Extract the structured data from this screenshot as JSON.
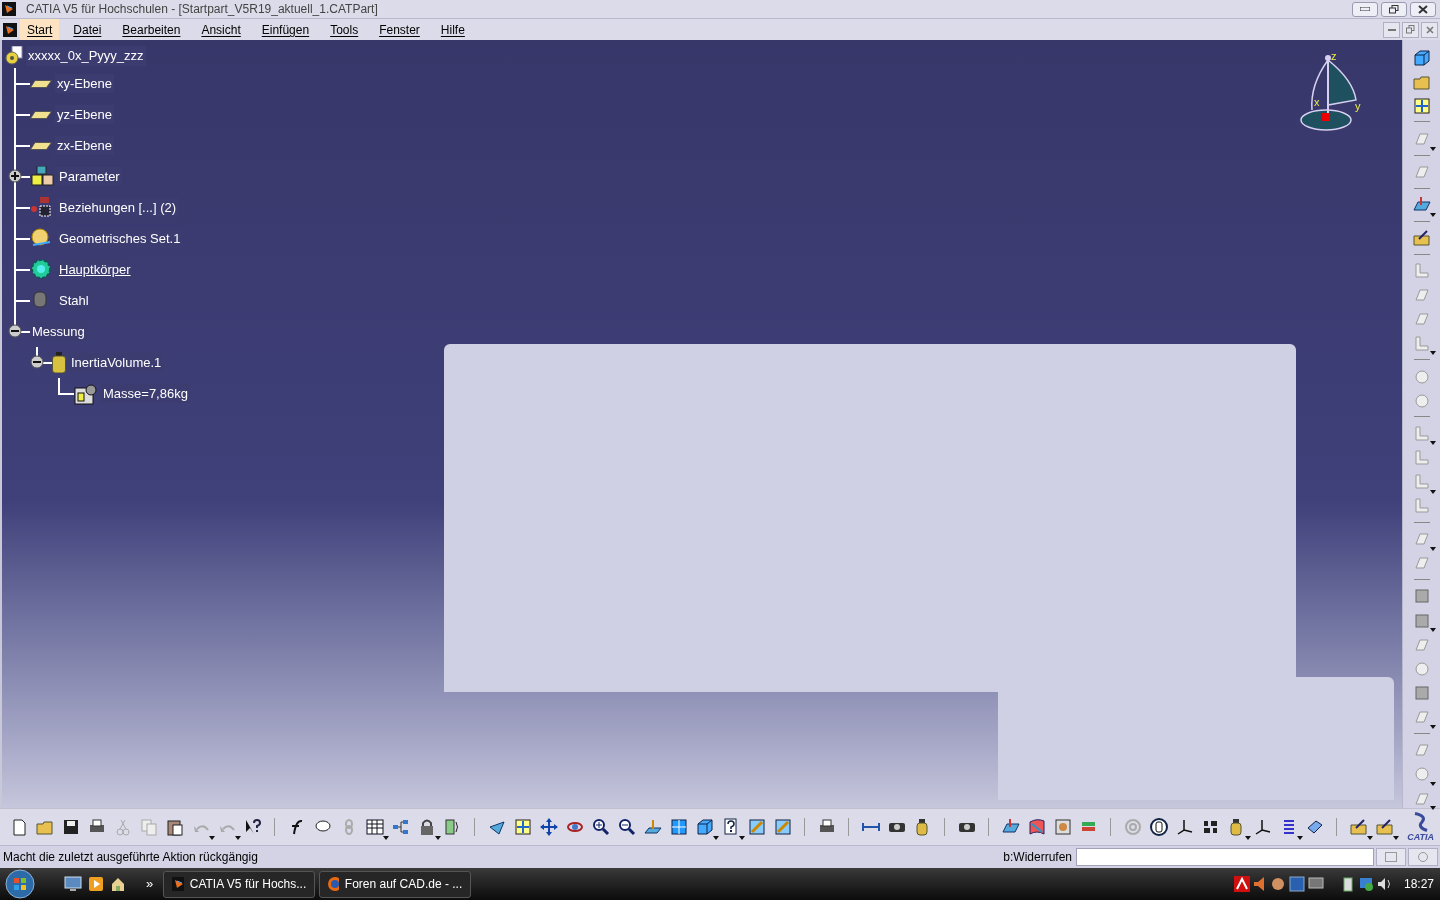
{
  "title_bar": {
    "title": "CATIA V5 für Hochschulen - [Startpart_V5R19_aktuell_1.CATPart]"
  },
  "menu": [
    {
      "label": "Start",
      "selected": true
    },
    {
      "label": "Datei",
      "selected": false
    },
    {
      "label": "Bearbeiten",
      "selected": false
    },
    {
      "label": "Ansicht",
      "selected": false
    },
    {
      "label": "Einfügen",
      "selected": false
    },
    {
      "label": "Tools",
      "selected": false
    },
    {
      "label": "Fenster",
      "selected": false
    },
    {
      "label": "Hilfe",
      "selected": false
    }
  ],
  "tree": {
    "label": "xxxxx_0x_Pyyy_zzz",
    "kind": "part",
    "children": [
      {
        "label": "xy-Ebene",
        "kind": "plane",
        "active": false
      },
      {
        "label": "yz-Ebene",
        "kind": "plane",
        "active": false
      },
      {
        "label": "zx-Ebene",
        "kind": "plane",
        "active": false
      },
      {
        "label": "Parameter",
        "kind": "parameter",
        "active": false,
        "expanded": false
      },
      {
        "label": "Beziehungen [...] (2)",
        "kind": "relations",
        "active": false
      },
      {
        "label": "Geometrisches Set.1",
        "kind": "geoset",
        "active": false
      },
      {
        "label": "Hauptkörper",
        "kind": "body",
        "active": true
      },
      {
        "label": "Stahl",
        "kind": "material",
        "active": false
      },
      {
        "label": "Messung",
        "kind": "measure",
        "active": false,
        "expanded": true,
        "children": [
          {
            "label": "InertiaVolume.1",
            "kind": "inertia",
            "active": false,
            "expanded": true,
            "children": [
              {
                "label": "Masse=7,86kg",
                "kind": "mass",
                "active": false
              }
            ]
          }
        ]
      }
    ]
  },
  "compass": {
    "axes": [
      "z",
      "x",
      "y"
    ]
  },
  "toolbar": {
    "logo_text": "CATIA"
  },
  "status_bar": {
    "message": "Macht die zuletzt ausgeführte Aktion rückgängig",
    "command_label": "b:Widerrufen"
  },
  "taskbar": {
    "overflow": "»",
    "buttons": [
      {
        "label": "CATIA V5 für Hochs...",
        "kind": "catia"
      },
      {
        "label": "Foren auf CAD.de - ...",
        "kind": "firefox"
      }
    ],
    "clock": "18:27"
  }
}
